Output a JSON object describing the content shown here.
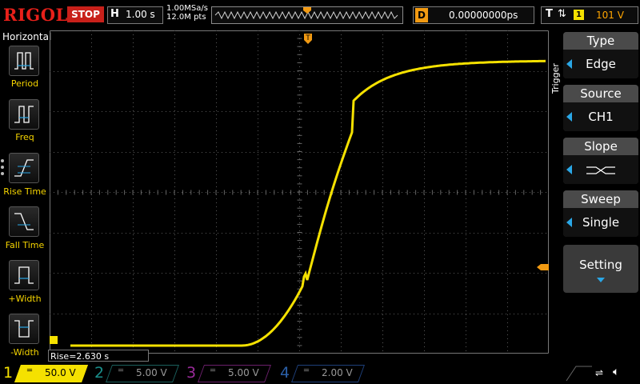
{
  "header": {
    "logo": "RIGOL",
    "run_status": "STOP",
    "horizontal": {
      "letter": "H",
      "timebase": "1.00 s"
    },
    "sample_rate": "1.00MSa/s",
    "memory_depth": "12.0M pts",
    "delay": {
      "letter": "D",
      "value": "0.00000000ps"
    },
    "trigger": {
      "letter": "T",
      "edge_symbol": "⇅",
      "source_num": "1",
      "level": "101 V"
    }
  },
  "left_menu": {
    "title": "Horizontal",
    "items": [
      {
        "label": "Period",
        "icon": "period-icon"
      },
      {
        "label": "Freq",
        "icon": "frequency-icon"
      },
      {
        "label": "Rise Time",
        "icon": "rise-time-icon"
      },
      {
        "label": "Fall Time",
        "icon": "fall-time-icon"
      },
      {
        "label": "+Width",
        "icon": "positive-width-icon"
      },
      {
        "label": "-Width",
        "icon": "negative-width-icon"
      }
    ]
  },
  "right_menu": {
    "title": "Trigger",
    "buttons": [
      {
        "title": "Type",
        "value": "Edge"
      },
      {
        "title": "Source",
        "value": "CH1"
      },
      {
        "title": "Slope",
        "value": "both-edges-icon"
      },
      {
        "title": "Sweep",
        "value": "Single"
      },
      {
        "title": "Setting",
        "value": ""
      }
    ]
  },
  "measurement": {
    "text": "Rise=2.630 s"
  },
  "channels": [
    {
      "num": "1",
      "scale": "50.0 V",
      "color": "#f5e100",
      "active": true
    },
    {
      "num": "2",
      "scale": "5.00 V",
      "color": "#1fd6d0",
      "active": false
    },
    {
      "num": "3",
      "scale": "5.00 V",
      "color": "#e03ae0",
      "active": false
    },
    {
      "num": "4",
      "scale": "2.00 V",
      "color": "#2a7df0",
      "active": false
    }
  ],
  "colors": {
    "trace": "#f5e100",
    "accent": "#f29a12",
    "stop": "#c8201a",
    "menu_arrow": "#2aa7e6"
  }
}
